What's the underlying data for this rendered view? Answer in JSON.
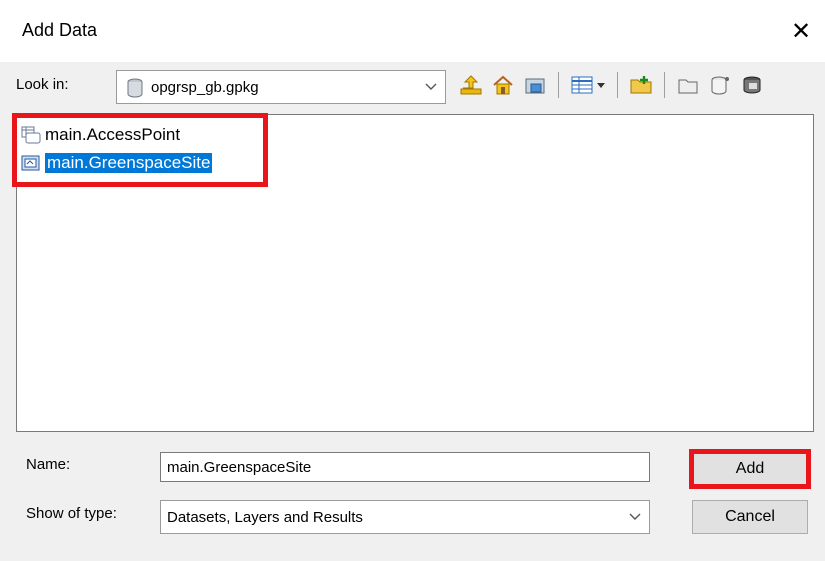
{
  "window": {
    "title": "Add Data",
    "close_glyph": "✕"
  },
  "look_in": {
    "label": "Look in:",
    "value": "opgrsp_gb.gpkg"
  },
  "toolbar": {
    "icons": [
      "up-one-level-icon",
      "home-icon",
      "connect-folder-icon",
      "view-menu-icon",
      "new-folder-icon",
      "new-item-icon",
      "geodatabase-icon",
      "layer-icon"
    ]
  },
  "files": [
    {
      "name": "main.AccessPoint",
      "icon": "table-icon",
      "selected": false
    },
    {
      "name": "main.GreenspaceSite",
      "icon": "feature-class-icon",
      "selected": true
    }
  ],
  "name_field": {
    "label": "Name:",
    "value": "main.GreenspaceSite"
  },
  "type_field": {
    "label": "Show of type:",
    "value": "Datasets, Layers and Results"
  },
  "buttons": {
    "add": "Add",
    "cancel": "Cancel"
  },
  "colors": {
    "selection": "#0078d7",
    "highlight_box": "#e8151b"
  }
}
